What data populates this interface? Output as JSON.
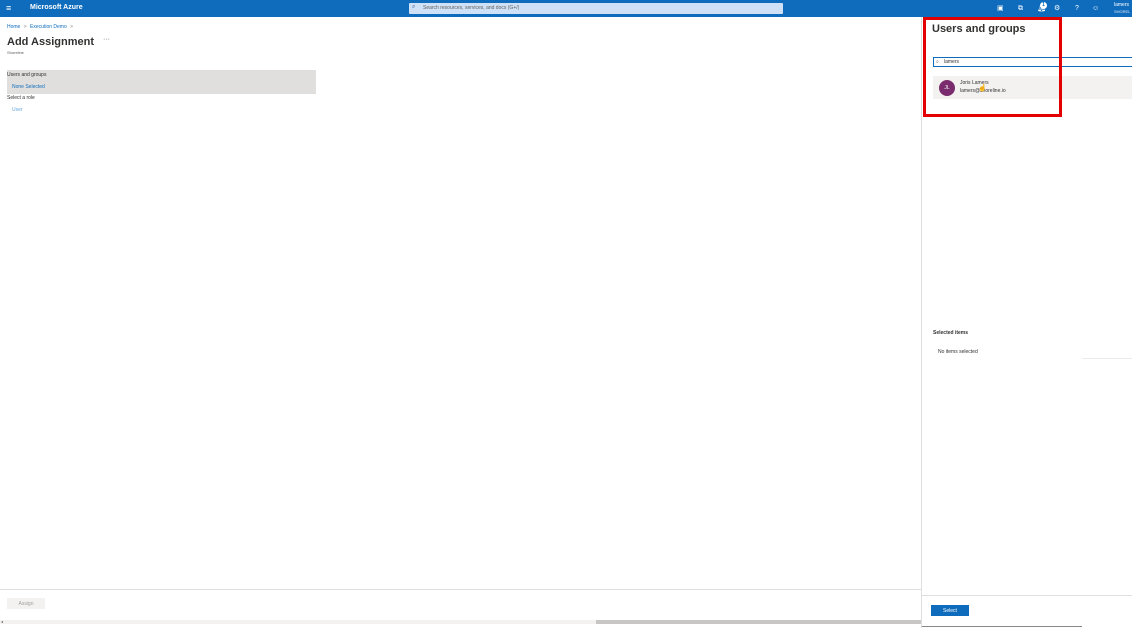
{
  "topbar": {
    "brand": "Microsoft Azure",
    "search_placeholder": "Search resources, services, and docs (G+/)",
    "notification_count": "1",
    "user_name": "lamers",
    "user_org": "SHOREL"
  },
  "breadcrumb": {
    "home": "Home",
    "parent": "Execution Demo",
    "sep": ">"
  },
  "page": {
    "title": "Add Assignment",
    "more": "···",
    "subtitle": "Shoreline"
  },
  "form": {
    "users_groups_label": "Users and groups",
    "users_groups_value": "None Selected",
    "role_label": "Select a role",
    "role_value": "User",
    "assign_label": "Assign"
  },
  "blade": {
    "title": "Users and groups",
    "search_value": "lamers",
    "result": {
      "initials": "JL",
      "name": "Joris Lamers",
      "email": "lamers@shoreline.io"
    },
    "selected_items_label": "Selected items",
    "no_items": "No items selected",
    "select_label": "Select"
  },
  "colors": {
    "accent": "#0f6cbd",
    "highlight": "#e30000",
    "avatar": "#7a2c6e"
  }
}
